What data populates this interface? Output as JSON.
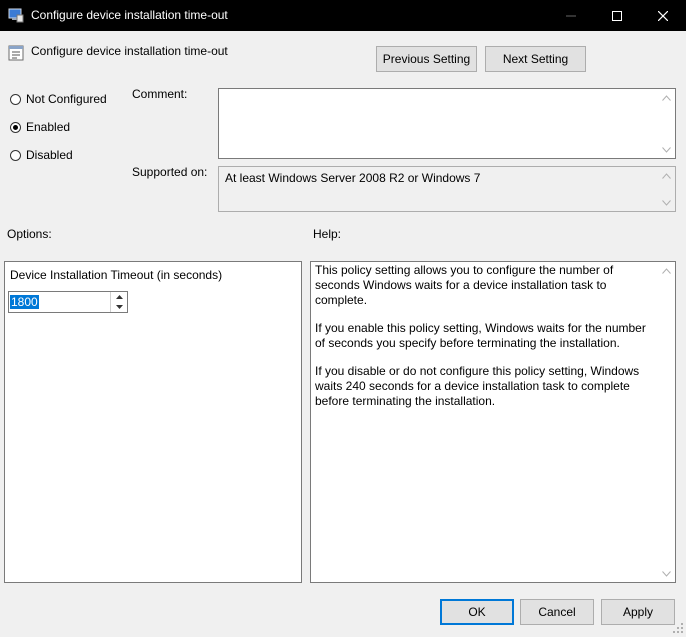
{
  "window": {
    "title": "Configure device installation time-out"
  },
  "header": {
    "title": "Configure device installation time-out"
  },
  "nav": {
    "previous": "Previous Setting",
    "next": "Next Setting"
  },
  "state": {
    "options": [
      {
        "label": "Not Configured",
        "selected": false
      },
      {
        "label": "Enabled",
        "selected": true
      },
      {
        "label": "Disabled",
        "selected": false
      }
    ]
  },
  "comment": {
    "label": "Comment:",
    "value": ""
  },
  "supported": {
    "label": "Supported on:",
    "value": "At least Windows Server 2008 R2 or Windows 7"
  },
  "options_section": {
    "label": "Options:",
    "timeout_label": "Device Installation Timeout (in seconds)",
    "timeout_value": "1800"
  },
  "help": {
    "label": "Help:",
    "paragraphs": [
      "This policy setting allows you to configure the number of seconds Windows waits for a device installation task to complete.",
      "If you enable this policy setting, Windows waits for the number of seconds you specify before terminating the installation.",
      "If you disable or do not configure this policy setting, Windows waits 240 seconds for a device installation task to complete before terminating the installation."
    ]
  },
  "buttons": {
    "ok": "OK",
    "cancel": "Cancel",
    "apply": "Apply"
  },
  "icons": [
    "app-icon",
    "policy-icon",
    "minimize-icon",
    "maximize-icon",
    "close-icon",
    "scroll-up-icon",
    "scroll-down-icon",
    "spin-up-icon",
    "spin-down-icon",
    "size-grip-icon"
  ],
  "colors": {
    "titlebar": "#000000",
    "accent": "#0078d7",
    "dialog_bg": "#f0f0f0"
  }
}
